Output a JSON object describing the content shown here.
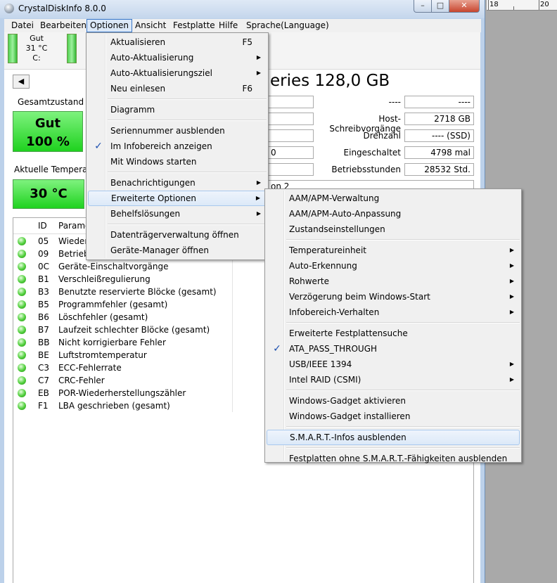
{
  "window": {
    "title": "CrystalDiskInfo 8.0.0"
  },
  "ruler": {
    "labels": [
      "18",
      "20"
    ]
  },
  "menubar": {
    "items": [
      "Datei",
      "Bearbeiten",
      "Optionen",
      "Ansicht",
      "Festplatte",
      "Hilfe",
      "Sprache(Language)"
    ]
  },
  "drive": {
    "status": "Gut",
    "temperature": "31 °C",
    "letter": "C:"
  },
  "model_partial": "eries 128,0 GB",
  "health": {
    "label": "Gesamtzustand",
    "status": "Gut",
    "percent": "100 %"
  },
  "temperature": {
    "label": "Aktuelle Temperat",
    "value": "30 °C"
  },
  "info": {
    "right_top_label": "----",
    "right_top_value": "----",
    "host_writes_label": "Host-Schreibvorgänge",
    "host_writes_value": "2718 GB",
    "rotation_label": "Drehzahl",
    "rotation_value": "---- (SSD)",
    "power_on_count_label": "Eingeschaltet",
    "power_on_count_value": "4798 mal",
    "power_on_hours_label": "Betriebsstunden",
    "power_on_hours_value": "28532 Std.",
    "left_partial_value": "0",
    "feature_partial": "on 2"
  },
  "table": {
    "headers": [
      "ID",
      "Parame"
    ],
    "rows": [
      {
        "id": "05",
        "name": "Wieder"
      },
      {
        "id": "09",
        "name": "Betrieb"
      },
      {
        "id": "0C",
        "name": "Geräte-Einschaltvorgänge"
      },
      {
        "id": "B1",
        "name": "Verschleißregulierung"
      },
      {
        "id": "B3",
        "name": "Benutzte reservierte Blöcke (gesamt)"
      },
      {
        "id": "B5",
        "name": "Programmfehler (gesamt)"
      },
      {
        "id": "B6",
        "name": "Löschfehler (gesamt)"
      },
      {
        "id": "B7",
        "name": "Laufzeit schlechter Blöcke (gesamt)"
      },
      {
        "id": "BB",
        "name": "Nicht korrigierbare Fehler"
      },
      {
        "id": "BE",
        "name": "Luftstromtemperatur"
      },
      {
        "id": "C3",
        "name": "ECC-Fehlerrate"
      },
      {
        "id": "C7",
        "name": "CRC-Fehler"
      },
      {
        "id": "EB",
        "name": "POR-Wiederherstellungszähler"
      },
      {
        "id": "F1",
        "name": "LBA geschrieben (gesamt)"
      }
    ]
  },
  "options_menu": {
    "items": [
      {
        "label": "Aktualisieren",
        "shortcut": "F5"
      },
      {
        "label": "Auto-Aktualisierung",
        "submenu": true
      },
      {
        "label": "Auto-Aktualisierungsziel",
        "submenu": true
      },
      {
        "label": "Neu einlesen",
        "shortcut": "F6"
      },
      {
        "label": "Diagramm"
      },
      {
        "label": "Seriennummer ausblenden"
      },
      {
        "label": "Im Infobereich anzeigen",
        "checked": true
      },
      {
        "label": "Mit Windows starten"
      },
      {
        "label": "Benachrichtigungen",
        "submenu": true
      },
      {
        "label": "Erweiterte Optionen",
        "submenu": true,
        "highlighted": true
      },
      {
        "label": "Behelfslösungen",
        "submenu": true
      },
      {
        "label": "Datenträgerverwaltung öffnen"
      },
      {
        "label": "Geräte-Manager öffnen"
      }
    ]
  },
  "advanced_menu": {
    "items": [
      {
        "label": "AAM/APM-Verwaltung"
      },
      {
        "label": "AAM/APM-Auto-Anpassung"
      },
      {
        "label": "Zustandseinstellungen"
      },
      {
        "label": "Temperatureinheit",
        "submenu": true
      },
      {
        "label": "Auto-Erkennung",
        "submenu": true
      },
      {
        "label": "Rohwerte",
        "submenu": true
      },
      {
        "label": "Verzögerung beim Windows-Start",
        "submenu": true
      },
      {
        "label": "Infobereich-Verhalten",
        "submenu": true
      },
      {
        "label": "Erweiterte Festplattensuche"
      },
      {
        "label": "ATA_PASS_THROUGH",
        "checked": true
      },
      {
        "label": "USB/IEEE 1394",
        "submenu": true
      },
      {
        "label": "Intel RAID (CSMI)",
        "submenu": true
      },
      {
        "label": "Windows-Gadget aktivieren"
      },
      {
        "label": "Windows-Gadget installieren"
      },
      {
        "label": "S.M.A.R.T.-Infos ausblenden",
        "highlighted": true
      },
      {
        "label": "Festplatten ohne S.M.A.R.T.-Fähigkeiten ausblenden"
      }
    ]
  },
  "glyphs": {
    "check": "✓",
    "arrow": "▶",
    "back": "◀",
    "minimize": "–",
    "maximize": "□",
    "close": "✕"
  },
  "colors": {
    "health_green": "#1fd21f",
    "menu_highlight": "#dce9f8",
    "check_blue": "#1c4fb0"
  }
}
